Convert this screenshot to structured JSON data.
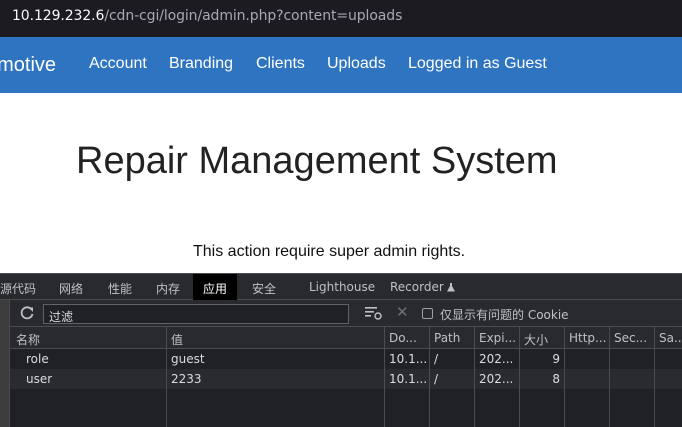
{
  "browser": {
    "url_host": "10.129.232.6",
    "url_path": "/cdn-cgi/login/admin.php?content=uploads"
  },
  "navbar": {
    "brand": "omotive",
    "links": [
      "Account",
      "Branding",
      "Clients",
      "Uploads",
      "Logged in as Guest"
    ]
  },
  "main": {
    "title": "Repair Management System",
    "message": "This action require super admin rights."
  },
  "devtools": {
    "tabs": [
      "源代码",
      "网络",
      "性能",
      "内存",
      "应用",
      "安全",
      "Lighthouse",
      "Recorder"
    ],
    "active_tab": "应用",
    "filter_placeholder": "过滤",
    "only_issues_label": "仅显示有问题的 Cookie",
    "columns": [
      "名称",
      "值",
      "Do...",
      "Path",
      "Expi...",
      "大小",
      "Http...",
      "Sec...",
      "Sa..."
    ],
    "rows": [
      [
        "role",
        "guest",
        "10.1...",
        "/",
        "202...",
        "9",
        "",
        "",
        ""
      ],
      [
        "user",
        "2233",
        "10.1...",
        "/",
        "202...",
        "8",
        "",
        "",
        ""
      ]
    ]
  },
  "colors": {
    "navbar": "#2e74c0",
    "devtools_bg": "#202124",
    "urlbar_bg": "#1c1b22"
  }
}
